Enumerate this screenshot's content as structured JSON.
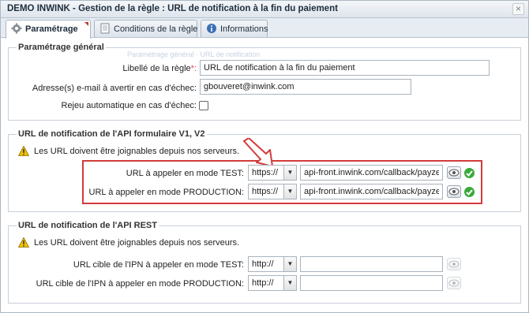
{
  "window": {
    "title": "DEMO INWINK - Gestion de la règle : URL de notification à la fin du paiement",
    "close_glyph": "×"
  },
  "tabs": [
    {
      "label": "Paramétrage",
      "icon": "gear-icon",
      "active": true
    },
    {
      "label": "Conditions de la règle",
      "icon": "document-icon",
      "active": false
    },
    {
      "label": "Informations",
      "icon": "info-icon",
      "active": false
    }
  ],
  "general": {
    "legend": "Paramétrage général",
    "rule_label": "Libellé de la règle",
    "rule_required": "*:",
    "rule_value": "URL de notification à la fin du paiement",
    "email_label": "Adresse(s) e-mail à avertir en cas d'échec:",
    "email_value": "gbouveret@inwink.com",
    "replay_label": "Rejeu automatique en cas d'échec:"
  },
  "api_form": {
    "legend": "URL de notification de l'API formulaire V1, V2",
    "warning": "Les URL doivent être joignables depuis nos serveurs.",
    "test_label": "URL à appeler en mode TEST:",
    "test_protocol": "https://",
    "test_url": "api-front.inwink.com/callback/payzen/payment",
    "prod_label": "URL à appeler en mode PRODUCTION:",
    "prod_protocol": "https://",
    "prod_url": "api-front.inwink.com/callback/payzen/payment"
  },
  "api_rest": {
    "legend": "URL de notification de l'API REST",
    "warning": "Les URL doivent être joignables depuis nos serveurs.",
    "test_label": "URL cible de l'IPN à appeler en mode TEST:",
    "test_protocol": "http://",
    "test_url": "",
    "prod_label": "URL cible de l'IPN à appeler en mode PRODUCTION:",
    "prod_protocol": "http://",
    "prod_url": ""
  },
  "colors": {
    "accent_red": "#d23b3b",
    "success_green": "#3aa83a",
    "warning_yellow": "#f2c200"
  }
}
